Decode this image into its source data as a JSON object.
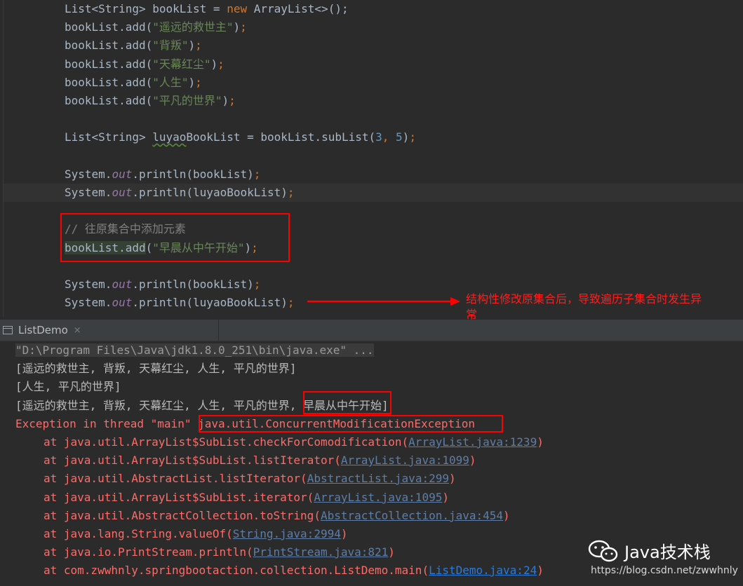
{
  "editor": {
    "lines": [
      {
        "p": [
          {
            "t": "List<String> bookList = "
          },
          {
            "t": "new",
            "c": "kw"
          },
          {
            "t": " ArrayList<>();"
          }
        ]
      },
      {
        "p": [
          {
            "t": "bookList.add("
          },
          {
            "t": "\"遥远的救世主\"",
            "c": "str"
          },
          {
            "t": ")"
          },
          {
            "t": ";",
            "c": "kw"
          }
        ]
      },
      {
        "p": [
          {
            "t": "bookList.add("
          },
          {
            "t": "\"背叛\"",
            "c": "str"
          },
          {
            "t": ")"
          },
          {
            "t": ";",
            "c": "kw"
          }
        ]
      },
      {
        "p": [
          {
            "t": "bookList.add("
          },
          {
            "t": "\"天幕红尘\"",
            "c": "str"
          },
          {
            "t": ")"
          },
          {
            "t": ";",
            "c": "kw"
          }
        ]
      },
      {
        "p": [
          {
            "t": "bookList.add("
          },
          {
            "t": "\"人生\"",
            "c": "str"
          },
          {
            "t": ")"
          },
          {
            "t": ";",
            "c": "kw"
          }
        ]
      },
      {
        "p": [
          {
            "t": "bookList.add("
          },
          {
            "t": "\"平凡的世界\"",
            "c": "str"
          },
          {
            "t": ")"
          },
          {
            "t": ";",
            "c": "kw"
          }
        ]
      },
      {
        "p": []
      },
      {
        "p": [
          {
            "t": "List<String> "
          },
          {
            "t": "luyao",
            "c": "warn"
          },
          {
            "t": "BookList = bookList.subList("
          },
          {
            "t": "3",
            "c": "num"
          },
          {
            "t": ", ",
            "c": "kw"
          },
          {
            "t": "5",
            "c": "num"
          },
          {
            "t": ")"
          },
          {
            "t": ";",
            "c": "kw"
          }
        ]
      },
      {
        "p": []
      },
      {
        "p": [
          {
            "t": "System."
          },
          {
            "t": "out",
            "c": "fld"
          },
          {
            "t": ".println(bookList)"
          },
          {
            "t": ";",
            "c": "kw"
          }
        ]
      },
      {
        "p": [
          {
            "t": "System."
          },
          {
            "t": "out",
            "c": "fld"
          },
          {
            "t": ".println(luyaoBookList)"
          },
          {
            "t": ";",
            "c": "kw"
          }
        ]
      },
      {
        "p": []
      },
      {
        "p": [
          {
            "t": "// 往原集合中添加元素",
            "c": "cmt"
          }
        ]
      },
      {
        "p": [
          {
            "t": "bookList.add",
            "c": "hl"
          },
          {
            "t": "("
          },
          {
            "t": "\"早晨从中午开始\"",
            "c": "str"
          },
          {
            "t": ")"
          },
          {
            "t": ";",
            "c": "kw"
          }
        ]
      },
      {
        "p": []
      },
      {
        "p": [
          {
            "t": "System."
          },
          {
            "t": "out",
            "c": "fld"
          },
          {
            "t": ".println(bookList)"
          },
          {
            "t": ";",
            "c": "kw"
          }
        ]
      },
      {
        "p": [
          {
            "t": "System."
          },
          {
            "t": "out",
            "c": "fld"
          },
          {
            "t": ".println(luyaoBookList)"
          },
          {
            "t": ";",
            "c": "kw"
          }
        ]
      }
    ]
  },
  "annotation": {
    "note": "结构性修改原集合后，导致遍历子集合时发生异常",
    "accent_color": "#ff0000"
  },
  "tab": {
    "label": "ListDemo",
    "close": "×",
    "icon": "console-icon"
  },
  "console": {
    "lines": [
      {
        "x": 22,
        "p": [
          {
            "t": "\"D:\\Program Files\\Java\\jdk1.8.0_251\\bin\\java.exe\" ...",
            "c": "cmdline"
          }
        ]
      },
      {
        "x": 22,
        "p": [
          {
            "t": "[遥远的救世主, 背叛, 天幕红尘, 人生, 平凡的世界]",
            "c": "out"
          }
        ]
      },
      {
        "x": 22,
        "p": [
          {
            "t": "[人生, 平凡的世界]",
            "c": "out"
          }
        ]
      },
      {
        "x": 22,
        "p": [
          {
            "t": "[遥远的救世主, 背叛, 天幕红尘, 人生, 平凡的世界, 早晨从中午开始]",
            "c": "out"
          }
        ]
      },
      {
        "x": 22,
        "p": [
          {
            "t": "Exception in thread \"main\" java.util.ConcurrentModificationException",
            "c": "err"
          }
        ]
      },
      {
        "x": 62,
        "p": [
          {
            "t": "at java.util.ArrayList$SubList.checkForComodification(",
            "c": "err"
          },
          {
            "t": "ArrayList.java:1239",
            "c": "link"
          },
          {
            "t": ")",
            "c": "err"
          }
        ]
      },
      {
        "x": 62,
        "p": [
          {
            "t": "at java.util.ArrayList$SubList.listIterator(",
            "c": "err"
          },
          {
            "t": "ArrayList.java:1099",
            "c": "link"
          },
          {
            "t": ")",
            "c": "err"
          }
        ]
      },
      {
        "x": 62,
        "p": [
          {
            "t": "at java.util.AbstractList.listIterator(",
            "c": "err"
          },
          {
            "t": "AbstractList.java:299",
            "c": "link"
          },
          {
            "t": ")",
            "c": "err"
          }
        ]
      },
      {
        "x": 62,
        "p": [
          {
            "t": "at java.util.ArrayList$SubList.iterator(",
            "c": "err"
          },
          {
            "t": "ArrayList.java:1095",
            "c": "link"
          },
          {
            "t": ")",
            "c": "err"
          }
        ]
      },
      {
        "x": 62,
        "p": [
          {
            "t": "at java.util.AbstractCollection.toString(",
            "c": "err"
          },
          {
            "t": "AbstractCollection.java:454",
            "c": "link"
          },
          {
            "t": ")",
            "c": "err"
          }
        ]
      },
      {
        "x": 62,
        "p": [
          {
            "t": "at java.lang.String.valueOf(",
            "c": "err"
          },
          {
            "t": "String.java:2994",
            "c": "link"
          },
          {
            "t": ")",
            "c": "err"
          }
        ]
      },
      {
        "x": 62,
        "p": [
          {
            "t": "at java.io.PrintStream.println(",
            "c": "err"
          },
          {
            "t": "PrintStream.java:821",
            "c": "link"
          },
          {
            "t": ")",
            "c": "err"
          }
        ]
      },
      {
        "x": 62,
        "p": [
          {
            "t": "at com.zwwhnly.springbootaction.collection.ListDemo.main(",
            "c": "err"
          },
          {
            "t": "ListDemo.java:24",
            "c": "link2"
          },
          {
            "t": ")",
            "c": "err"
          }
        ]
      }
    ]
  },
  "watermark": {
    "brand": "Java技术栈",
    "url": "https://blog.csdn.net/zwwhnly",
    "icon": "wechat-icon"
  }
}
